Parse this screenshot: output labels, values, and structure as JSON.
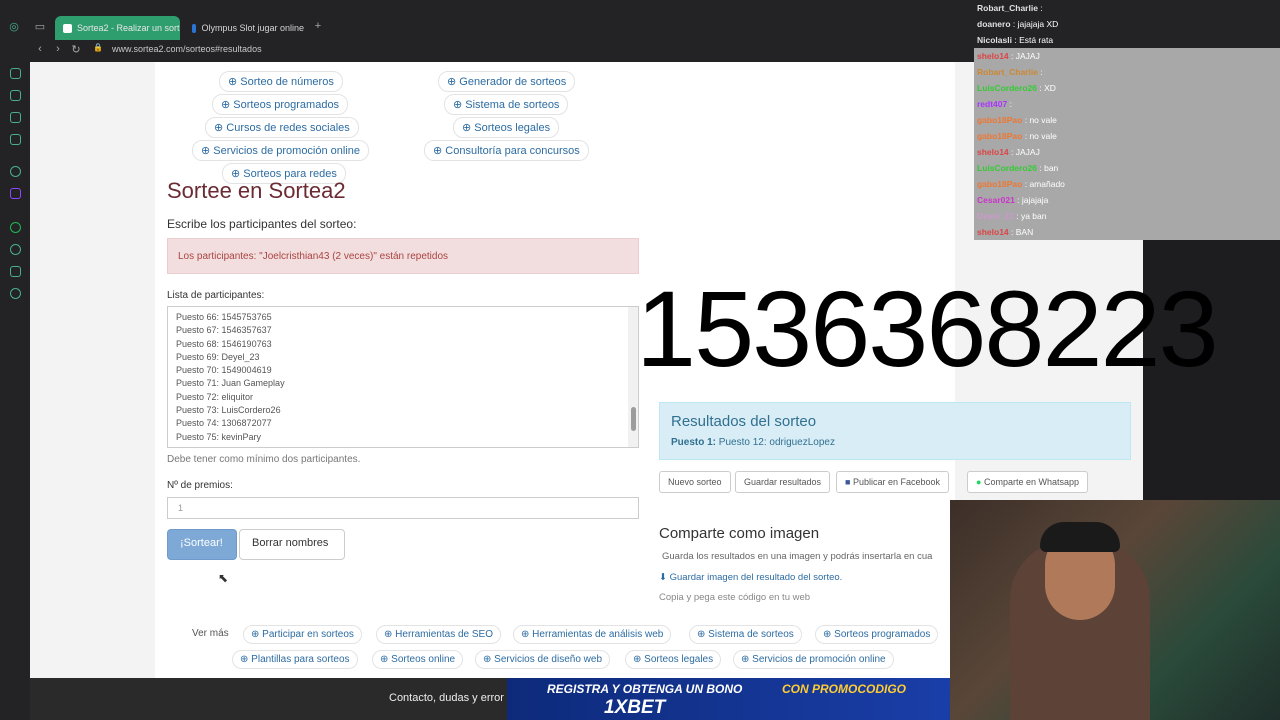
{
  "browser": {
    "tabs": [
      {
        "label": "Sortea2 - Realizar un sort"
      },
      {
        "label": "Olympus Slot jugar online"
      }
    ],
    "url": "www.sortea2.com/sorteos#resultados"
  },
  "top_links": [
    "Sorteo de números",
    "Generador de sorteos",
    "Sorteos programados",
    "Sistema de sorteos",
    "Cursos de redes sociales",
    "Sorteos legales",
    "Servicios de promoción online",
    "Consultoría para concursos",
    "Sorteos para redes"
  ],
  "main": {
    "title": "Sortee en Sortea2",
    "subtitle": "Escribe los participantes del sorteo:",
    "alert": "Los participantes: \"Joelcristhian43 (2 veces)\" están repetidos",
    "list_label": "Lista de participantes:",
    "participants": [
      "Puesto 66: 1545753765",
      "Puesto 67: 1546357637",
      "Puesto 68: 1546190763",
      "Puesto 69: Deyel_23",
      "Puesto 70: 1549004619",
      "Puesto 71: Juan Gameplay",
      "Puesto 72: eliquitor",
      "Puesto 73: LuisCordero26",
      "Puesto 74: 1306872077",
      "Puesto 75: kevinPary"
    ],
    "hint": "Debe tener como mínimo dos participantes.",
    "prizes_label": "Nº de premios:",
    "prizes_value": "1",
    "btn_draw": "¡Sortear!",
    "btn_clear": "Borrar nombres"
  },
  "big_number": "1536368223",
  "results": {
    "title": "Resultados del sorteo",
    "winner_prefix": "Puesto 1:",
    "winner": "Puesto 12: odriguezLopez"
  },
  "share_buttons": [
    "Nuevo sorteo",
    "Guardar resultados",
    "Publicar en Facebook",
    "Comparte en Whatsapp"
  ],
  "share_image": {
    "title": "Comparte como imagen",
    "desc": "Guarda los resultados en una imagen y podrás insertarla en cua",
    "link": "Guardar imagen del resultado del sorteo.",
    "code": "Copia y pega este código en tu web"
  },
  "ver_mas": {
    "label": "Ver más",
    "links": [
      "Participar en sorteos",
      "Herramientas de SEO",
      "Herramientas de análisis web",
      "Sistema de sorteos",
      "Sorteos programados",
      "Plantillas para sorteos",
      "Sorteos online",
      "Servicios de diseño web",
      "Sorteos legales",
      "Servicios de promoción online"
    ]
  },
  "footer_text": "Contacto, dudas y error",
  "banner": {
    "line1": "REGISTRA Y OBTENGA UN BONO",
    "line1b": "CON PROMOCODIGO",
    "brand": "1XBET"
  },
  "chat": [
    {
      "user": "Robart_Charlie",
      "msg": "",
      "color": "#e0e0e0",
      "bg": "dark"
    },
    {
      "user": "doanero",
      "msg": "jajajaja XD",
      "color": "#e0e0e0",
      "bg": "dark"
    },
    {
      "user": "Nicolasli",
      "msg": "Está rata",
      "color": "#e0e0e0",
      "bg": "dark"
    },
    {
      "user": "shelo14",
      "msg": "JAJAJ",
      "color": "#d44",
      "bg": "grey"
    },
    {
      "user": "Robart_Charlie",
      "msg": "",
      "color": "#c83",
      "bg": "grey"
    },
    {
      "user": "LuisCordero26",
      "msg": "XD",
      "color": "#3c3",
      "bg": "grey"
    },
    {
      "user": "redt407",
      "msg": "",
      "color": "#a3f",
      "bg": "grey"
    },
    {
      "user": "gabo18Pao",
      "msg": "no vale",
      "color": "#e73",
      "bg": "grey"
    },
    {
      "user": "gabo18Pao",
      "msg": "no vale",
      "color": "#e73",
      "bg": "grey"
    },
    {
      "user": "shelo14",
      "msg": "JAJAJ",
      "color": "#d44",
      "bg": "grey"
    },
    {
      "user": "LuisCordero26",
      "msg": "ban",
      "color": "#3c3",
      "bg": "grey"
    },
    {
      "user": "gabo18Pao",
      "msg": "amañado",
      "color": "#e73",
      "bg": "grey"
    },
    {
      "user": "Cesar021",
      "msg": "jajajaja",
      "color": "#c3c",
      "bg": "grey"
    },
    {
      "user": "Deyel_23",
      "msg": "ya ban",
      "color": "#c9c",
      "bg": "grey"
    },
    {
      "user": "shelo14",
      "msg": "BAN",
      "color": "#d44",
      "bg": "grey"
    }
  ]
}
